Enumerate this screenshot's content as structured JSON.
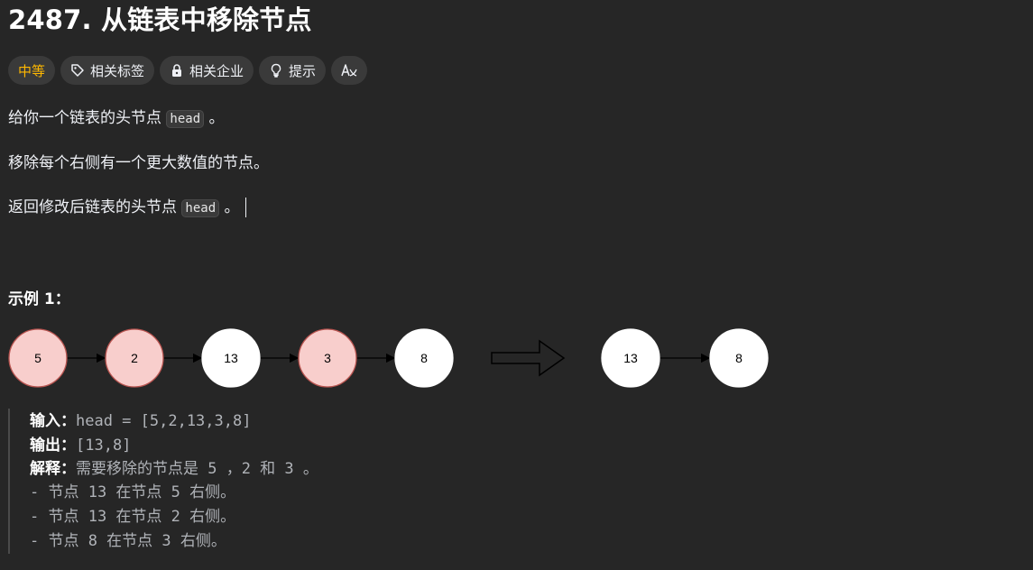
{
  "problem": {
    "title": "2487. 从链表中移除节点",
    "difficulty": "中等",
    "tags": [
      {
        "label": "相关标签",
        "icon": "tag-icon"
      },
      {
        "label": "相关企业",
        "icon": "lock-icon"
      },
      {
        "label": "提示",
        "icon": "lightbulb-icon"
      }
    ],
    "translate_icon": "translate-icon",
    "desc": {
      "p1_pre": "给你一个链表的头节点",
      "p1_code": "head",
      "p1_post": "。",
      "p2": "移除每个右侧有一个更大数值的节点。",
      "p3_pre": "返回修改后链表的头节点",
      "p3_code": "head",
      "p3_post": "。"
    }
  },
  "example": {
    "title": "示例 1：",
    "diagram": {
      "before": [
        "5",
        "2",
        "13",
        "3",
        "8"
      ],
      "removed": [
        "5",
        "2",
        "3"
      ],
      "after": [
        "13",
        "8"
      ]
    },
    "input_label": "输入：",
    "input_value": "head = [5,2,13,3,8]",
    "output_label": "输出：",
    "output_value": "[13,8]",
    "explain_label": "解释：",
    "explain_value": "需要移除的节点是 5 ，2 和 3 。",
    "lines": [
      "- 节点 13 在节点 5 右侧。",
      "- 节点 13 在节点 2 右侧。",
      "- 节点 8 在节点 3 右侧。"
    ]
  },
  "colors": {
    "background": "#262626",
    "difficulty": "#ffb800",
    "removed_fill": "#f8cecc",
    "removed_stroke": "#b85450",
    "node_fill": "#ffffff"
  }
}
